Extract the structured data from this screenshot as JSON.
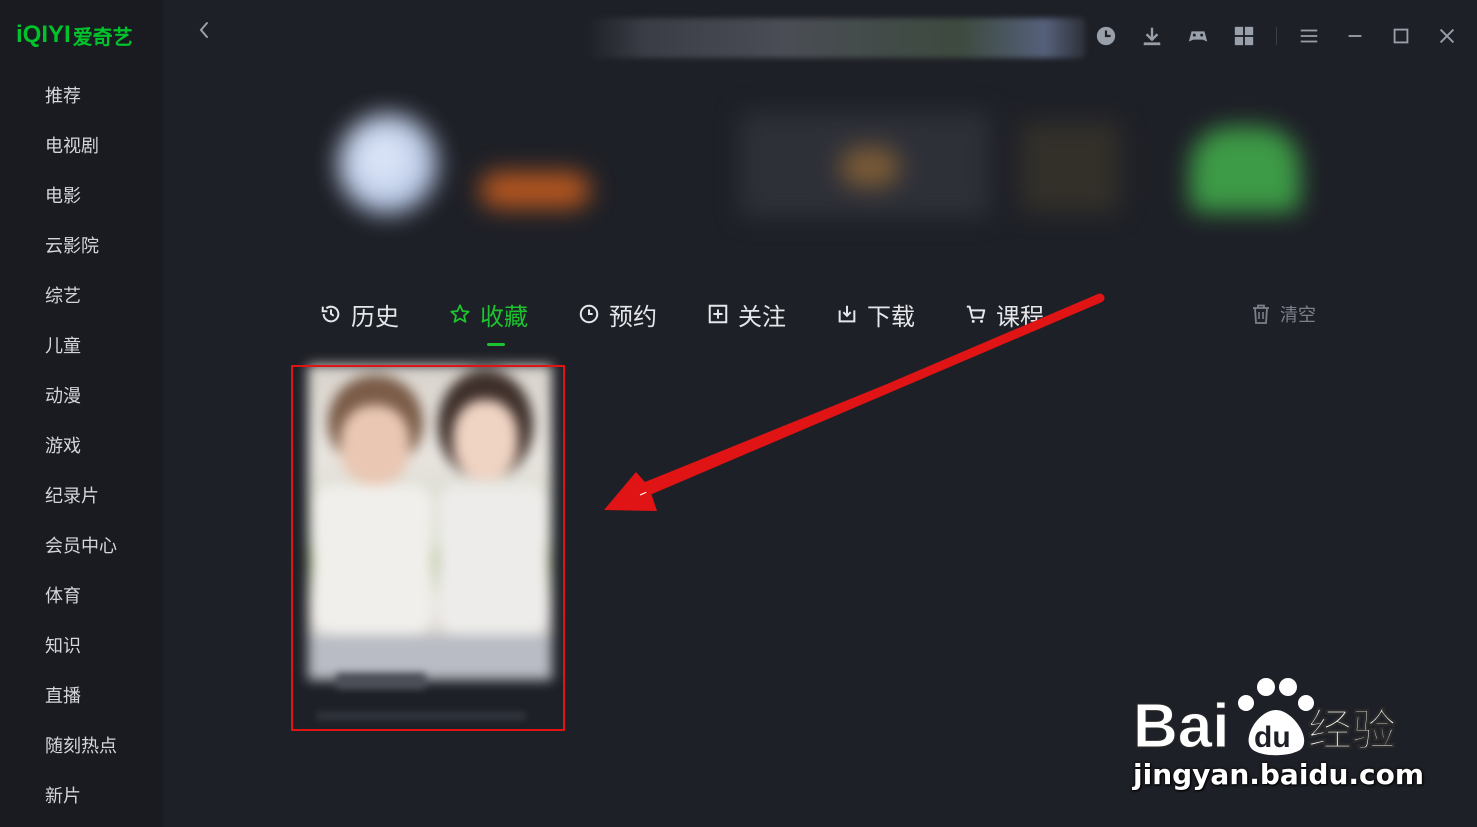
{
  "app": {
    "logo_brand": "iQIYI",
    "logo_cn": "爱奇艺"
  },
  "sidebar": {
    "items": [
      {
        "label": "推荐"
      },
      {
        "label": "电视剧"
      },
      {
        "label": "电影"
      },
      {
        "label": "云影院"
      },
      {
        "label": "综艺"
      },
      {
        "label": "儿童"
      },
      {
        "label": "动漫"
      },
      {
        "label": "游戏"
      },
      {
        "label": "纪录片"
      },
      {
        "label": "会员中心"
      },
      {
        "label": "体育"
      },
      {
        "label": "知识"
      },
      {
        "label": "直播"
      },
      {
        "label": "随刻热点"
      },
      {
        "label": "新片"
      }
    ]
  },
  "topbar": {
    "icons": [
      "clock-icon",
      "download-icon",
      "gamepad-icon",
      "apps-grid-icon",
      "menu-icon",
      "minimize-icon",
      "maximize-icon",
      "close-icon"
    ]
  },
  "tabs": [
    {
      "label": "历史",
      "icon": "history-icon",
      "active": false
    },
    {
      "label": "收藏",
      "icon": "star-icon",
      "active": true
    },
    {
      "label": "预约",
      "icon": "clock-icon",
      "active": false
    },
    {
      "label": "关注",
      "icon": "follow-icon",
      "active": false
    },
    {
      "label": "下载",
      "icon": "download-icon",
      "active": false
    },
    {
      "label": "课程",
      "icon": "cart-icon",
      "active": false
    }
  ],
  "clear_label": "清空",
  "colors": {
    "accent": "#1dc22f",
    "annotation": "#e01414",
    "background": "#1e2027",
    "sidebar": "#191b21"
  },
  "watermark": {
    "logo_text": "Bai du 经验",
    "url": "jingyan.baidu.com"
  }
}
